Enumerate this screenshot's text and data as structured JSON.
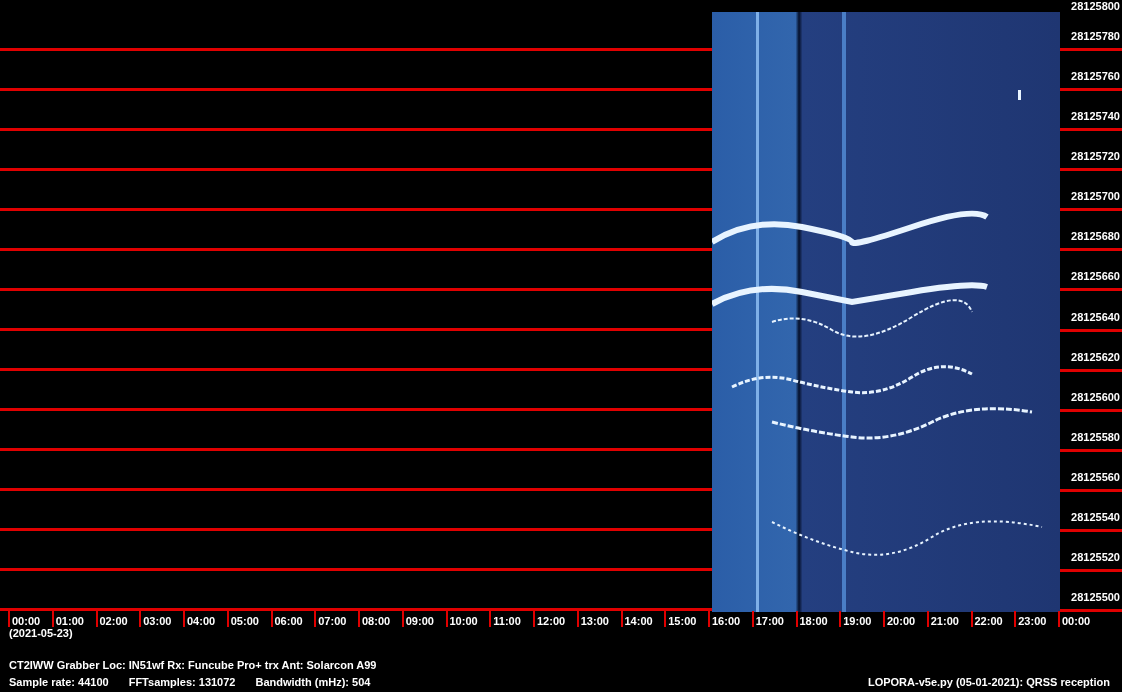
{
  "freq_labels": [
    "28125800",
    "28125780",
    "28125760",
    "28125740",
    "28125720",
    "28125700",
    "28125680",
    "28125660",
    "28125640",
    "28125620",
    "28125600",
    "28125580",
    "28125560",
    "28125540",
    "28125520",
    "28125500"
  ],
  "time_labels": [
    "00:00",
    "01:00",
    "02:00",
    "03:00",
    "04:00",
    "05:00",
    "06:00",
    "07:00",
    "08:00",
    "09:00",
    "10:00",
    "11:00",
    "12:00",
    "13:00",
    "14:00",
    "15:00",
    "16:00",
    "17:00",
    "18:00",
    "19:00",
    "20:00",
    "21:00",
    "22:00",
    "23:00",
    "00:00"
  ],
  "date": "(2021-05-23)",
  "station_info": "CT2IWW Grabber Loc: IN51wf Rx: Funcube Pro+ trx Ant: Solarcon A99",
  "params": [
    "Sample rate: 44100",
    "FFTsamples: 131072",
    "Bandwidth (mHz): 504"
  ],
  "footer_right": "LOPORA-v5e.py (05-01-2021): QRSS reception"
}
